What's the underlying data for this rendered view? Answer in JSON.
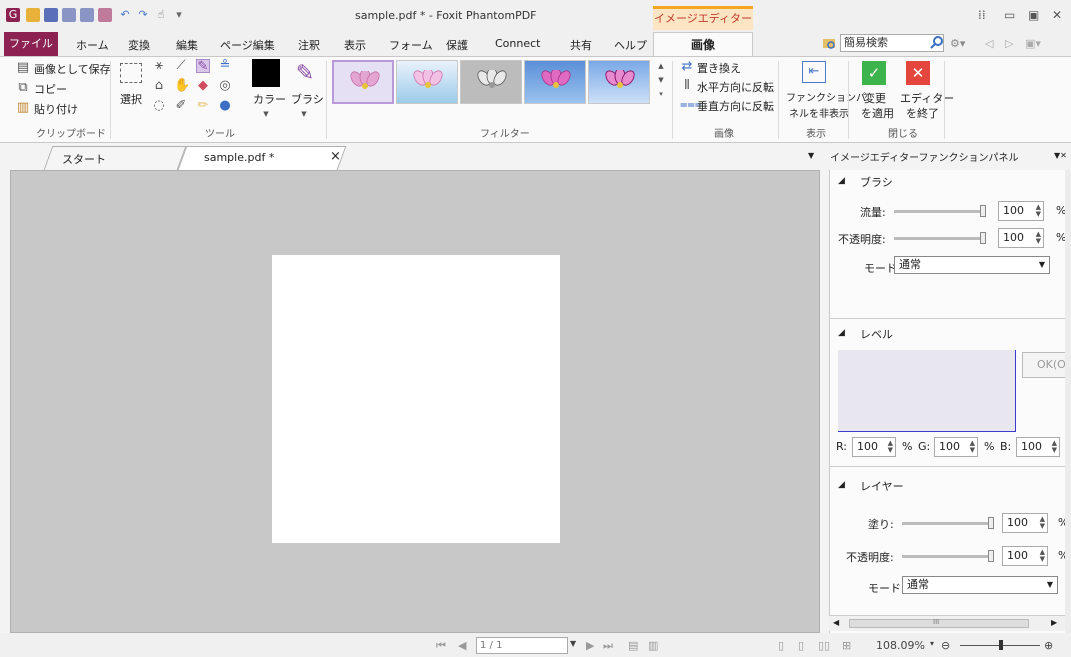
{
  "title_bar": {
    "doc_title": "sample.pdf * - Foxit PhantomPDF",
    "context_label": "イメージエディター"
  },
  "menu": {
    "items": [
      "ファイル",
      "ホーム",
      "変換",
      "編集",
      "ページ編集",
      "注釈",
      "表示",
      "フォーム",
      "保護",
      "Connect",
      "共有",
      "ヘルプ",
      "画像"
    ],
    "search_placeholder": "簡易検索"
  },
  "ribbon": {
    "clipboard": {
      "save_as_image": "画像として保存",
      "copy": "コピー",
      "paste": "貼り付け",
      "group": "クリップボード"
    },
    "tools": {
      "select": "選択",
      "color": "カラー",
      "brush": "ブラシ",
      "group": "ツール"
    },
    "filter": {
      "group": "フィルター"
    },
    "image": {
      "replace": "置き換え",
      "flip_h": "水平方向に反転",
      "flip_v": "垂直方向に反転",
      "group": "画像"
    },
    "display": {
      "hide_panel_1": "ファンクションパ",
      "hide_panel_2": "ネルを非表示",
      "group": "表示"
    },
    "close": {
      "apply_1": "変更",
      "apply_2": "を適用",
      "exit_1": "エディター",
      "exit_2": "を終了",
      "group": "閉じる"
    }
  },
  "tabs": {
    "start": "スタート",
    "doc": "sample.pdf *",
    "close": "×"
  },
  "panel": {
    "title": "イメージエディターファンクションパネル",
    "brush": {
      "section": "ブラシ",
      "flow_label": "流量:",
      "flow": "100",
      "opacity_label": "不透明度:",
      "opacity": "100",
      "mode_label": "モード:",
      "mode": "通常",
      "pct": "%"
    },
    "level": {
      "section": "レベル",
      "ok": "OK(O",
      "r_label": "R:",
      "r": "100",
      "g_label": "G:",
      "g": "100",
      "b_label": "B:",
      "b": "100",
      "pct": "%"
    },
    "layer": {
      "section": "レイヤー",
      "fill_label": "塗り:",
      "fill": "100",
      "opacity_label": "不透明度:",
      "opacity": "100",
      "mode_label": "モード:",
      "mode": "通常",
      "pct": "%"
    },
    "scroll_mark": "III"
  },
  "status": {
    "page": "1 / 1",
    "zoom": "108.09%"
  }
}
